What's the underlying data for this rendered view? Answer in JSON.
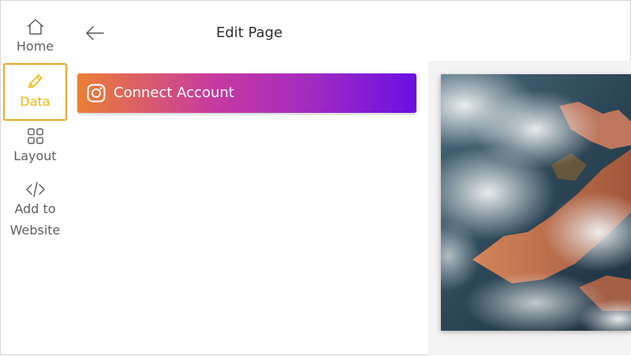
{
  "sidebar": {
    "items": [
      {
        "id": "home",
        "label": "Home",
        "icon": "home-icon",
        "active": false
      },
      {
        "id": "data",
        "label": "Data",
        "icon": "pencil-icon",
        "active": true
      },
      {
        "id": "layout",
        "label": "Layout",
        "icon": "grid-icon",
        "active": false
      },
      {
        "id": "add",
        "label_line1": "Add to",
        "label_line2": "Website",
        "icon": "code-icon",
        "active": false
      }
    ]
  },
  "header": {
    "title": "Edit Page",
    "back_icon": "arrow-left-icon"
  },
  "connect": {
    "label": "Connect Account",
    "icon": "instagram-icon"
  },
  "colors": {
    "active_accent": "#f0b400",
    "active_border": "#e8a72a",
    "gradient_start": "#ea7f35",
    "gradient_mid": "#c73aa0",
    "gradient_end": "#6a0fe3",
    "text_muted": "#5f5f5f"
  }
}
